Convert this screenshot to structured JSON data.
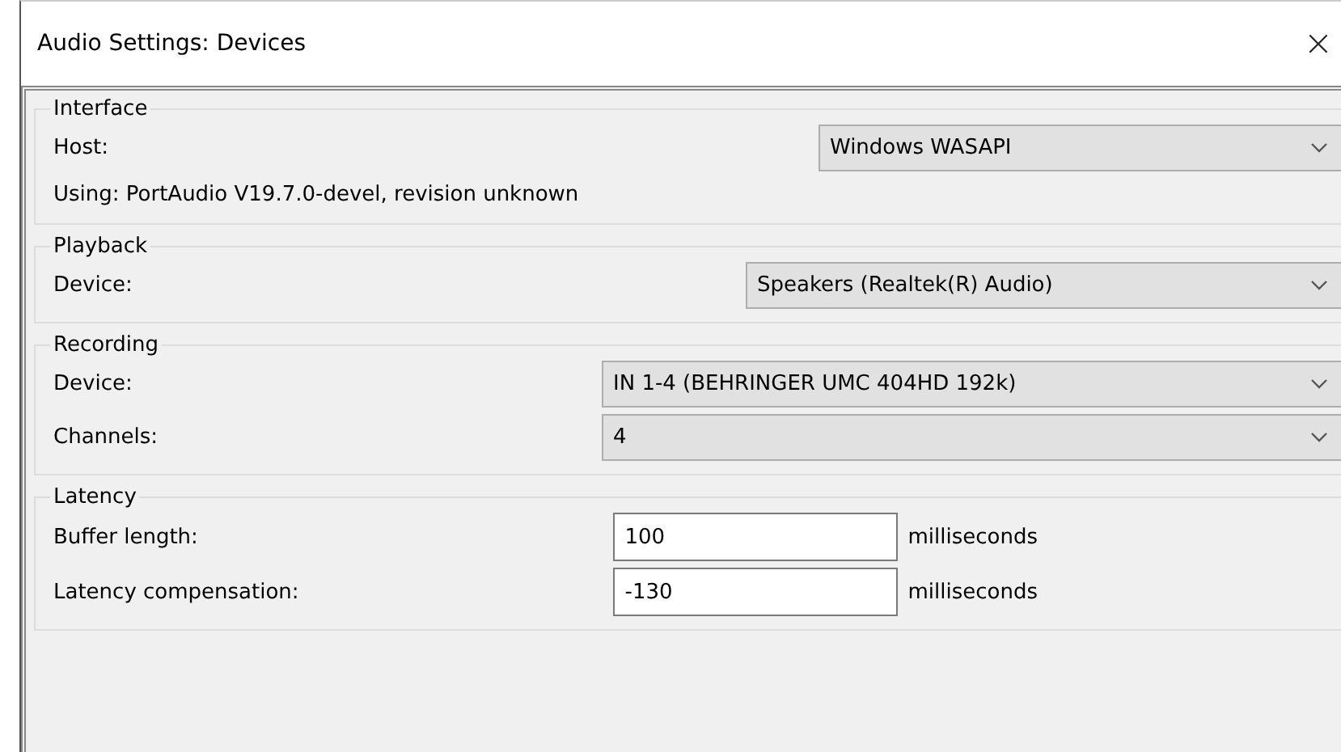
{
  "window": {
    "title": "Audio Settings: Devices",
    "close": "×"
  },
  "groups": [
    {
      "title": "Interface",
      "rows": [
        {
          "kind": "select",
          "label": "Host:",
          "value": "Windows WASAPI"
        },
        {
          "kind": "text",
          "text": "Using: PortAudio V19.7.0-devel, revision unknown"
        }
      ]
    },
    {
      "title": "Playback",
      "rows": [
        {
          "kind": "select",
          "label": "Device:",
          "value": "Speakers (Realtek(R) Audio)"
        }
      ]
    },
    {
      "title": "Recording",
      "rows": [
        {
          "kind": "select",
          "label": "Device:",
          "value": "IN 1-4 (BEHRINGER UMC 404HD 192k)"
        },
        {
          "kind": "select",
          "label": "Channels:",
          "value": "4"
        }
      ]
    },
    {
      "title": "Latency",
      "rows": [
        {
          "kind": "input",
          "label": "Buffer length:",
          "value": "100",
          "unit": "milliseconds"
        },
        {
          "kind": "input",
          "label": "Latency compensation:",
          "value": "-130",
          "unit": "milliseconds"
        }
      ]
    }
  ]
}
